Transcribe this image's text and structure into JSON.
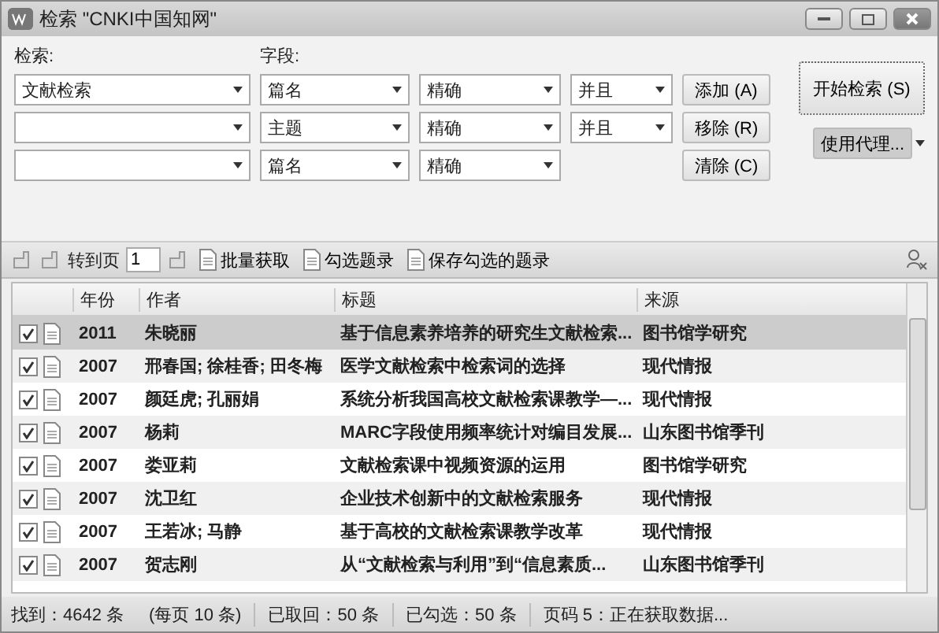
{
  "window": {
    "title": "检索 \"CNKI中国知网\""
  },
  "search": {
    "field_label": "检索:",
    "column_label": "字段:",
    "rows": [
      {
        "source": "文献检索",
        "field": "篇名",
        "match": "精确",
        "logic": "并且",
        "button": "添加 (A)"
      },
      {
        "source": "",
        "field": "主题",
        "match": "精确",
        "logic": "并且",
        "button": "移除 (R)"
      },
      {
        "source": "",
        "field": "篇名",
        "match": "精确",
        "button": "清除 (C)"
      }
    ],
    "start_button": "开始检索 (S)",
    "proxy_button": "使用代理..."
  },
  "toolbar": {
    "goto_label": "转到页",
    "page": "1",
    "batch": "批量获取",
    "check": "勾选题录",
    "save": "保存勾选的题录"
  },
  "table": {
    "columns": [
      "年份",
      "作者",
      "标题",
      "来源"
    ],
    "rows": [
      {
        "checked": true,
        "selected": true,
        "year": "2011",
        "author": "朱晓丽",
        "title": "基于信息素养培养的研究生文献检索...",
        "source": "图书馆学研究"
      },
      {
        "checked": true,
        "selected": false,
        "year": "2007",
        "author": "邢春国; 徐桂香; 田冬梅",
        "title": "医学文献检索中检索词的选择",
        "source": "现代情报"
      },
      {
        "checked": true,
        "selected": false,
        "year": "2007",
        "author": "颜廷虎; 孔丽娟",
        "title": "系统分析我国高校文献检索课教学—...",
        "source": "现代情报"
      },
      {
        "checked": true,
        "selected": false,
        "year": "2007",
        "author": "杨莉",
        "title": "MARC字段使用频率统计对编目发展...",
        "source": "山东图书馆季刊"
      },
      {
        "checked": true,
        "selected": false,
        "year": "2007",
        "author": "娄亚莉",
        "title": "文献检索课中视频资源的运用",
        "source": "图书馆学研究"
      },
      {
        "checked": true,
        "selected": false,
        "year": "2007",
        "author": "沈卫红",
        "title": "企业技术创新中的文献检索服务",
        "source": "现代情报"
      },
      {
        "checked": true,
        "selected": false,
        "year": "2007",
        "author": "王若冰; 马静",
        "title": "基于高校的文献检索课教学改革",
        "source": "现代情报"
      },
      {
        "checked": true,
        "selected": false,
        "year": "2007",
        "author": "贺志刚",
        "title": "从“文献检索与利用”到“信息素质...",
        "source": "山东图书馆季刊"
      }
    ]
  },
  "status_bar": [
    "找到：4642 条",
    "(每页 10 条)",
    "已取回：50 条",
    "已勾选：50 条",
    "页码 5：正在获取数据..."
  ]
}
